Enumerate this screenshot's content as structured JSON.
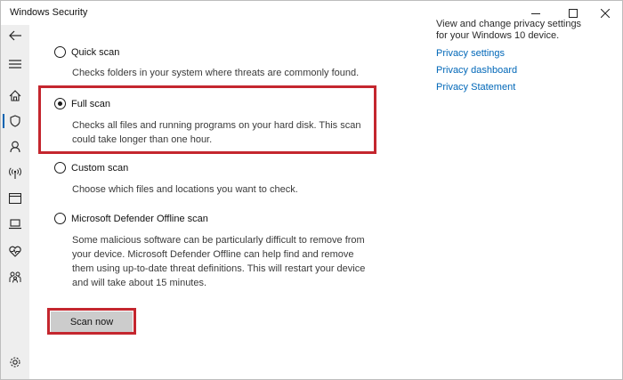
{
  "window": {
    "title": "Windows Security",
    "controls": [
      "minimize-icon",
      "maximize-icon",
      "close-icon"
    ]
  },
  "sidebar": {
    "items": [
      {
        "name": "back",
        "icon": "back-arrow-icon"
      },
      {
        "name": "menu",
        "icon": "hamburger-icon"
      },
      {
        "name": "home",
        "icon": "home-icon"
      },
      {
        "name": "virus-threat-protection",
        "icon": "shield-icon",
        "active": true
      },
      {
        "name": "account-protection",
        "icon": "person-icon"
      },
      {
        "name": "firewall-network",
        "icon": "wireless-icon"
      },
      {
        "name": "app-browser-control",
        "icon": "browser-window-icon"
      },
      {
        "name": "device-security",
        "icon": "laptop-icon"
      },
      {
        "name": "device-performance-health",
        "icon": "heart-icon"
      },
      {
        "name": "family-options",
        "icon": "family-icon"
      },
      {
        "name": "settings",
        "icon": "gear-icon"
      }
    ]
  },
  "scan_options": [
    {
      "label": "Quick scan",
      "checked": false,
      "description": [
        "Checks folders in your system where threats are commonly found."
      ]
    },
    {
      "label": "Full scan",
      "checked": true,
      "description": [
        "Checks all files and running programs on your hard disk. This scan",
        "could take longer than one hour."
      ]
    },
    {
      "label": "Custom scan",
      "checked": false,
      "description": [
        "Choose which files and locations you want to check."
      ]
    },
    {
      "label": "Microsoft Defender Offline scan",
      "checked": false,
      "description": [
        "Some malicious software can be particularly difficult to remove from",
        "your device. Microsoft Defender Offline can help find and remove",
        "them using up-to-date threat definitions. This will restart your device",
        "and will take about 15 minutes."
      ]
    }
  ],
  "scan_button": {
    "label": "Scan now"
  },
  "privacy": {
    "clipped_text": "View and change privacy settings",
    "text": "for your Windows 10 device.",
    "links": [
      "Privacy settings",
      "Privacy dashboard",
      "Privacy Statement"
    ]
  },
  "colors": {
    "highlight": "#c4262e",
    "link": "#0067b8",
    "sidebar_bg": "#eeeeee",
    "button_bg": "#cccccc"
  }
}
